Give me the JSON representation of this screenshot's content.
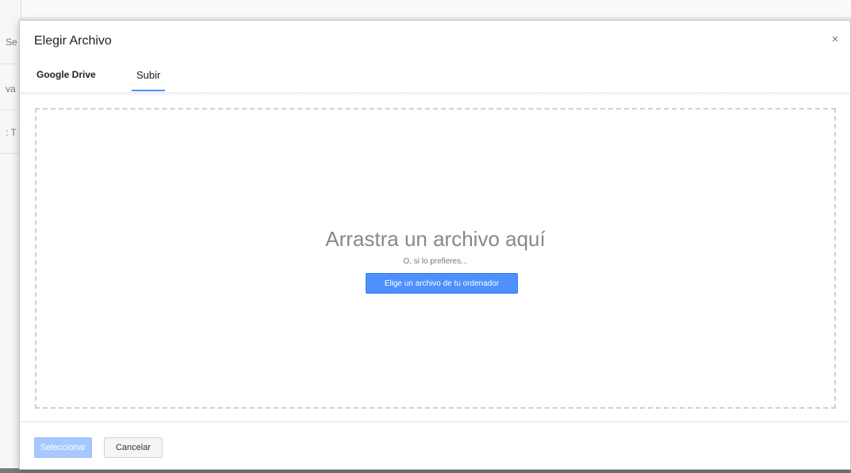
{
  "background": {
    "left_fragments": [
      "Se",
      "va",
      ": T"
    ]
  },
  "dialog": {
    "title": "Elegir Archivo",
    "close_glyph": "×",
    "tabs": [
      {
        "label": "Google Drive",
        "active": false
      },
      {
        "label": "Subir",
        "active": true
      }
    ],
    "dropzone": {
      "heading": "Arrastra un archivo aquí",
      "subtext": "O, si lo prefieres...",
      "choose_button": "Elige un archivo de tu ordenador"
    },
    "footer": {
      "select_button": "Seleccionar",
      "cancel_button": "Cancelar"
    }
  },
  "colors": {
    "accent": "#4d90fe",
    "accent_disabled": "#a6c8ff"
  }
}
